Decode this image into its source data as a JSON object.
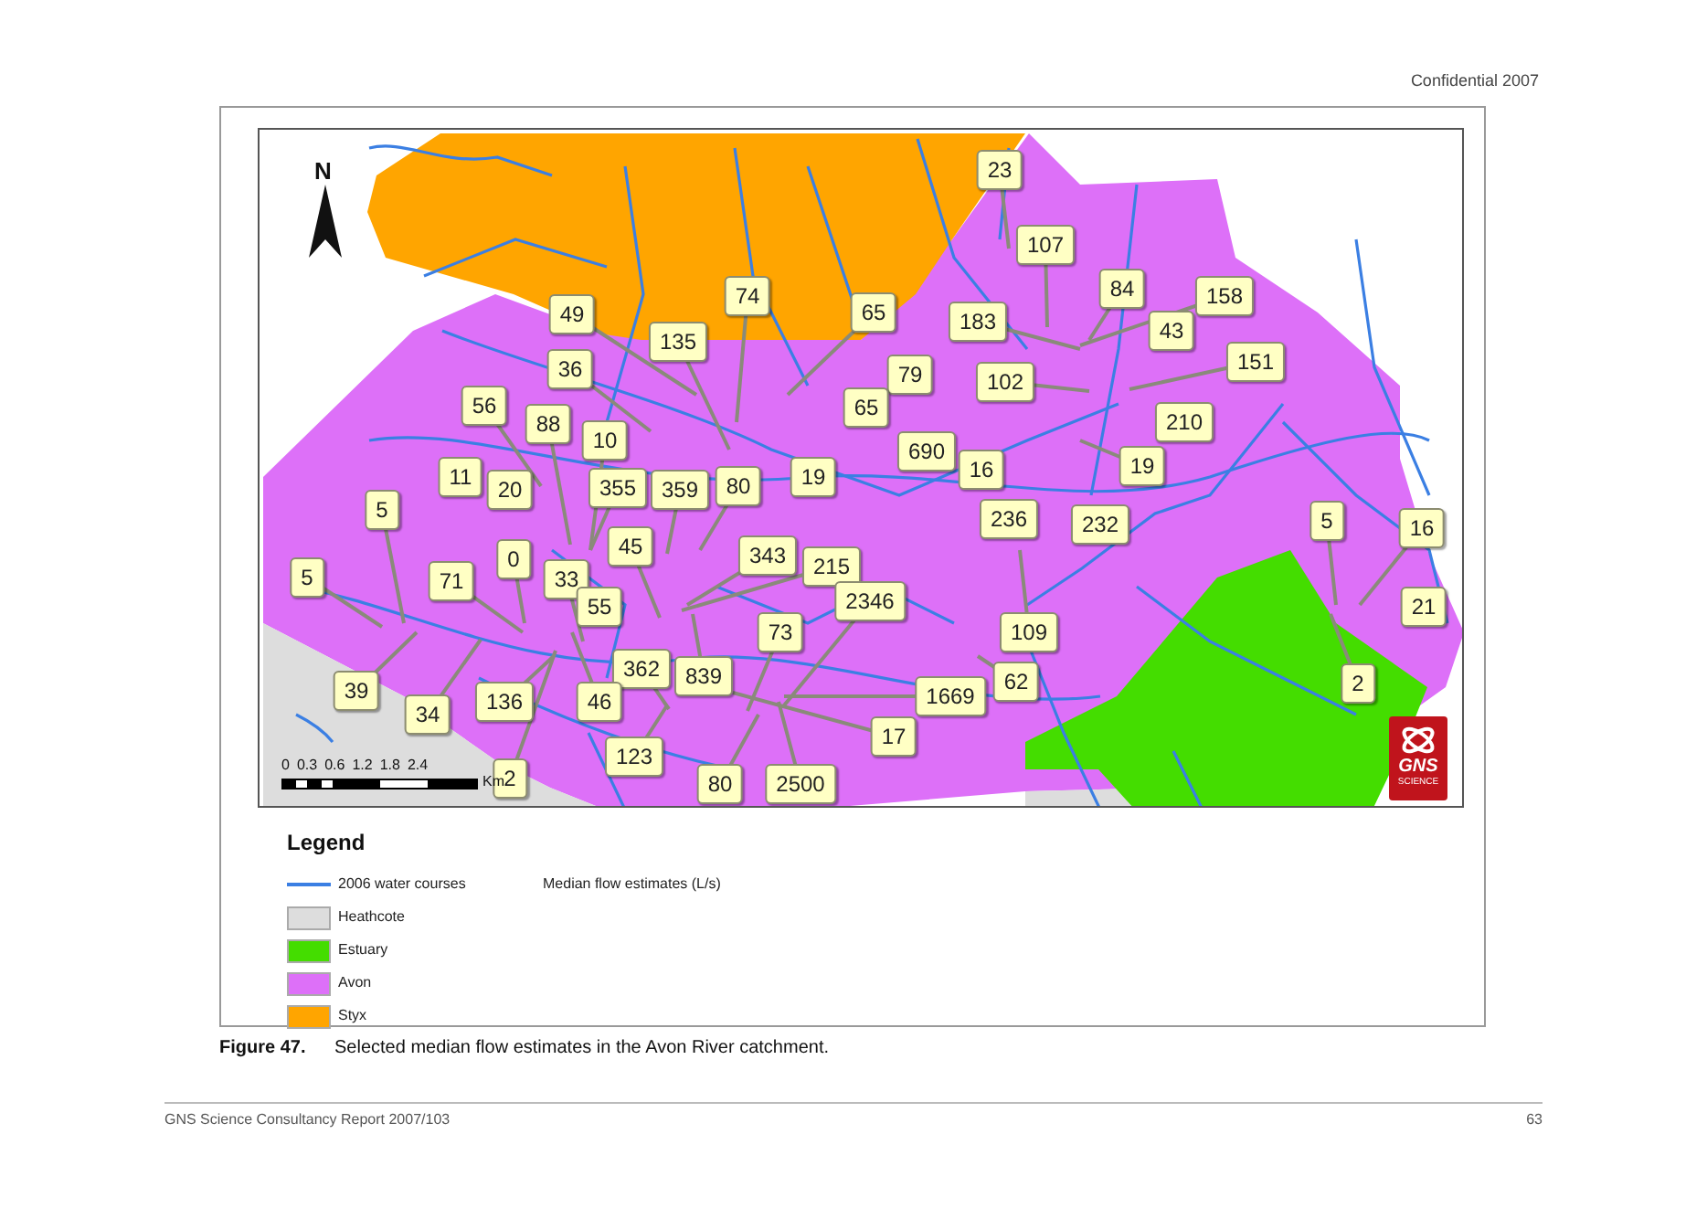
{
  "header": {
    "text": "Confidential 2007"
  },
  "figure": {
    "map": {
      "north_label": "N",
      "callouts": [
        {
          "value": "23"
        },
        {
          "value": "107"
        },
        {
          "value": "49"
        },
        {
          "value": "74"
        },
        {
          "value": "65"
        },
        {
          "value": "183"
        },
        {
          "value": "84"
        },
        {
          "value": "158"
        },
        {
          "value": "135"
        },
        {
          "value": "43"
        },
        {
          "value": "36"
        },
        {
          "value": "79"
        },
        {
          "value": "102"
        },
        {
          "value": "151"
        },
        {
          "value": "56"
        },
        {
          "value": "88"
        },
        {
          "value": "65"
        },
        {
          "value": "210"
        },
        {
          "value": "10"
        },
        {
          "value": "690"
        },
        {
          "value": "11"
        },
        {
          "value": "20"
        },
        {
          "value": "355"
        },
        {
          "value": "359"
        },
        {
          "value": "80"
        },
        {
          "value": "19"
        },
        {
          "value": "16"
        },
        {
          "value": "19"
        },
        {
          "value": "5"
        },
        {
          "value": "236"
        },
        {
          "value": "232"
        },
        {
          "value": "5"
        },
        {
          "value": "16"
        },
        {
          "value": "0"
        },
        {
          "value": "45"
        },
        {
          "value": "343"
        },
        {
          "value": "215"
        },
        {
          "value": "5"
        },
        {
          "value": "71"
        },
        {
          "value": "33"
        },
        {
          "value": "55"
        },
        {
          "value": "2346"
        },
        {
          "value": "21"
        },
        {
          "value": "73"
        },
        {
          "value": "109"
        },
        {
          "value": "362"
        },
        {
          "value": "839"
        },
        {
          "value": "62"
        },
        {
          "value": "2"
        },
        {
          "value": "39"
        },
        {
          "value": "34"
        },
        {
          "value": "136"
        },
        {
          "value": "46"
        },
        {
          "value": "1669"
        },
        {
          "value": "123"
        },
        {
          "value": "17"
        },
        {
          "value": "2"
        },
        {
          "value": "80"
        },
        {
          "value": "2500"
        }
      ],
      "scale_bar": {
        "ticks": [
          "0",
          "0.3",
          "0.6",
          "1.2",
          "1.8",
          "2.4"
        ],
        "unit": "Km"
      },
      "logo": {
        "name": "GNS",
        "subtext": "SCIENCE"
      }
    },
    "legend": {
      "title": "Legend",
      "note": "Median flow estimates (L/s)",
      "items": [
        {
          "kind": "line",
          "label": "2006 water courses",
          "color": "#3b7fe3"
        },
        {
          "kind": "area",
          "label": "Heathcote",
          "color": "#dddddd"
        },
        {
          "kind": "area",
          "label": "Estuary",
          "color": "#44dd00"
        },
        {
          "kind": "area",
          "label": "Avon",
          "color": "#dd70f8"
        },
        {
          "kind": "area",
          "label": "Styx",
          "color": "#ffa500"
        }
      ]
    }
  },
  "caption": {
    "label": "Figure 47.",
    "text": "Selected median flow estimates in the Avon River catchment."
  },
  "footer": {
    "left": "GNS Science Consultancy Report 2007/103",
    "page": "63"
  }
}
